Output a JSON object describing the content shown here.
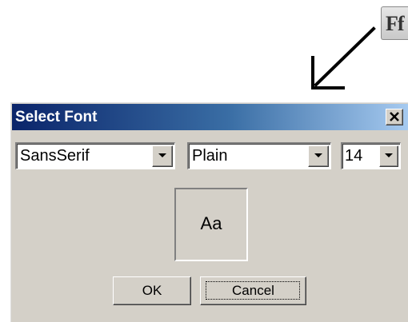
{
  "toolbar": {
    "font_button_glyph": "Ff",
    "font_button_icon": "font-icon"
  },
  "dialog": {
    "title": "Select Font",
    "close_icon": "close-icon",
    "font_family": {
      "value": "SansSerif"
    },
    "font_style": {
      "value": "Plain"
    },
    "font_size": {
      "value": "14"
    },
    "preview_text": "Aa",
    "ok_label": "OK",
    "cancel_label": "Cancel"
  },
  "colors": {
    "titlebar_start": "#0a246a",
    "titlebar_end": "#a6caf0",
    "dialog_face": "#d4d0c8"
  }
}
